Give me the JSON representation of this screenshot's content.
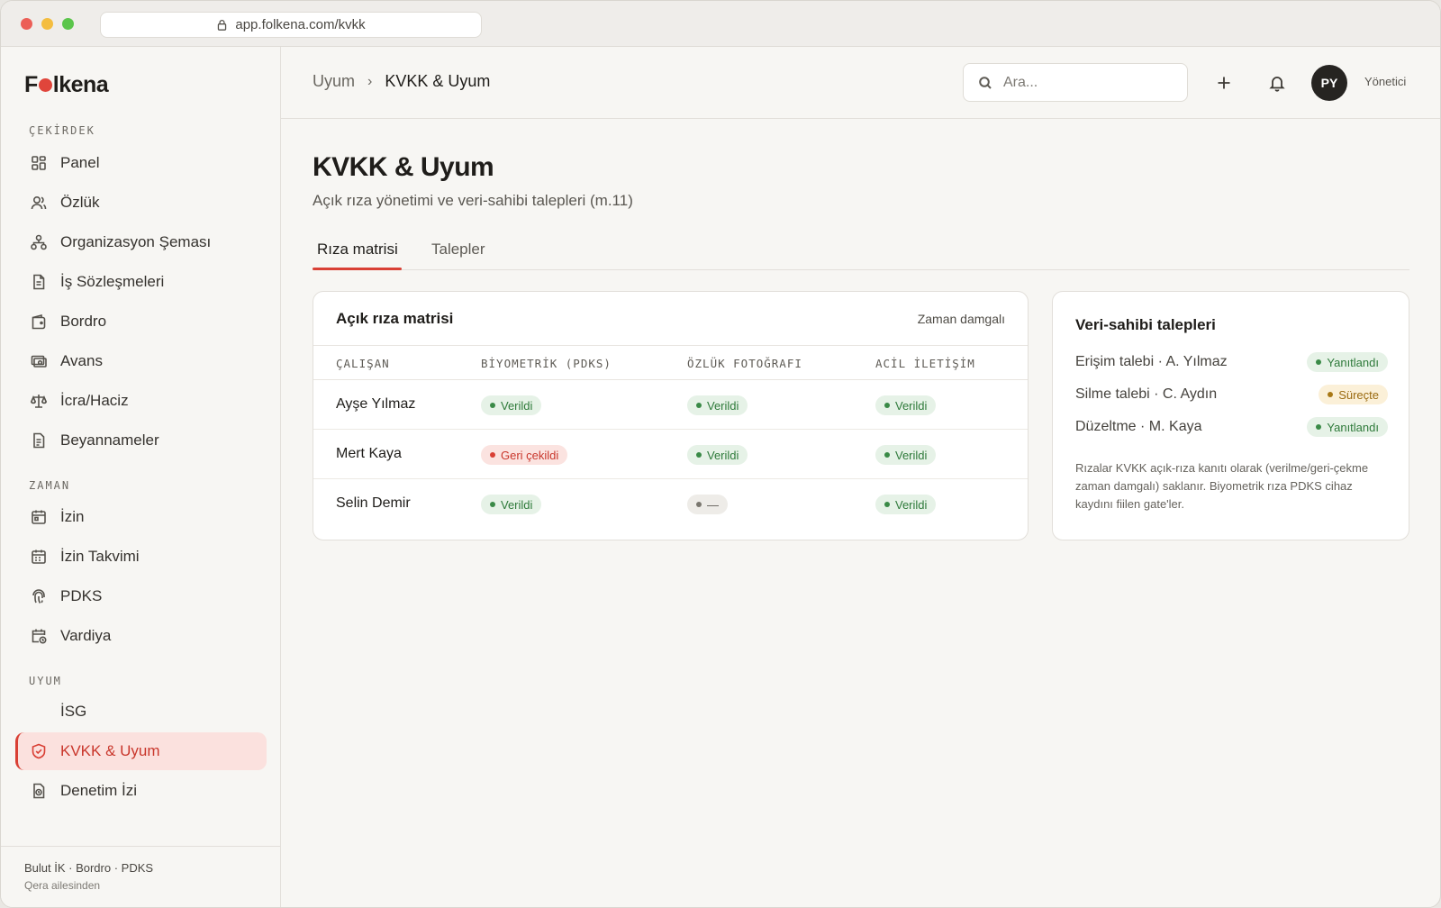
{
  "browser": {
    "url": "app.folkena.com/kvkk"
  },
  "brand": {
    "name_before": "F",
    "name_after": "lkena",
    "accent": "#e0453b"
  },
  "sidebar": {
    "sections": {
      "core": "ÇEKİRDEK",
      "time": "ZAMAN",
      "compliance": "UYUM"
    },
    "items": {
      "panel": "Panel",
      "ozluk": "Özlük",
      "org": "Organizasyon Şeması",
      "contracts": "İş Sözleşmeleri",
      "payroll": "Bordro",
      "advance": "Avans",
      "garnish": "İcra/Haciz",
      "declarations": "Beyannameler",
      "leave": "İzin",
      "leave_calendar": "İzin Takvimi",
      "pdks": "PDKS",
      "shift": "Vardiya",
      "isg": "İSG",
      "kvkk": "KVKK & Uyum",
      "audit": "Denetim İzi"
    },
    "active_item": "kvkk",
    "footer": {
      "line1": "Bulut İK · Bordro · PDKS",
      "line2": "Qera ailesinden"
    }
  },
  "topbar": {
    "breadcrumb": [
      "Uyum",
      "KVKK & Uyum"
    ],
    "search_placeholder": "Ara...",
    "avatar_initials": "PY",
    "role": "Yönetici"
  },
  "page": {
    "title": "KVKK & Uyum",
    "subtitle": "Açık rıza yönetimi ve veri-sahibi talepleri (m.11)",
    "tabs": [
      "Rıza matrisi",
      "Talepler"
    ],
    "active_tab": 0
  },
  "consent_matrix": {
    "title": "Açık rıza matrisi",
    "meta": "Zaman damgalı",
    "columns": [
      "ÇALIŞAN",
      "BİYOMETRİK (PDKS)",
      "ÖZLÜK FOTOĞRAFI",
      "ACİL İLETİŞİM"
    ],
    "rows": [
      {
        "name": "Ayşe Yılmaz",
        "cells": [
          {
            "label": "Verildi",
            "status": "ok"
          },
          {
            "label": "Verildi",
            "status": "ok"
          },
          {
            "label": "Verildi",
            "status": "ok"
          }
        ]
      },
      {
        "name": "Mert Kaya",
        "cells": [
          {
            "label": "Geri çekildi",
            "status": "bad"
          },
          {
            "label": "Verildi",
            "status": "ok"
          },
          {
            "label": "Verildi",
            "status": "ok"
          }
        ]
      },
      {
        "name": "Selin Demir",
        "cells": [
          {
            "label": "Verildi",
            "status": "ok"
          },
          {
            "label": "—",
            "status": "none"
          },
          {
            "label": "Verildi",
            "status": "ok"
          }
        ]
      }
    ]
  },
  "requests": {
    "title": "Veri-sahibi talepleri",
    "items": [
      {
        "type": "Erişim talebi",
        "person": "A. Yılmaz",
        "status": "Yanıtlandı",
        "status_kind": "ok"
      },
      {
        "type": "Silme talebi",
        "person": "C. Aydın",
        "status": "Süreçte",
        "status_kind": "warn"
      },
      {
        "type": "Düzeltme",
        "person": "M. Kaya",
        "status": "Yanıtlandı",
        "status_kind": "ok"
      }
    ],
    "note": "Rızalar KVKK açık-rıza kanıtı olarak (verilme/geri-çekme zaman damgalı) saklanır. Biyometrik rıza PDKS cihaz kaydını fiilen gate'ler."
  }
}
